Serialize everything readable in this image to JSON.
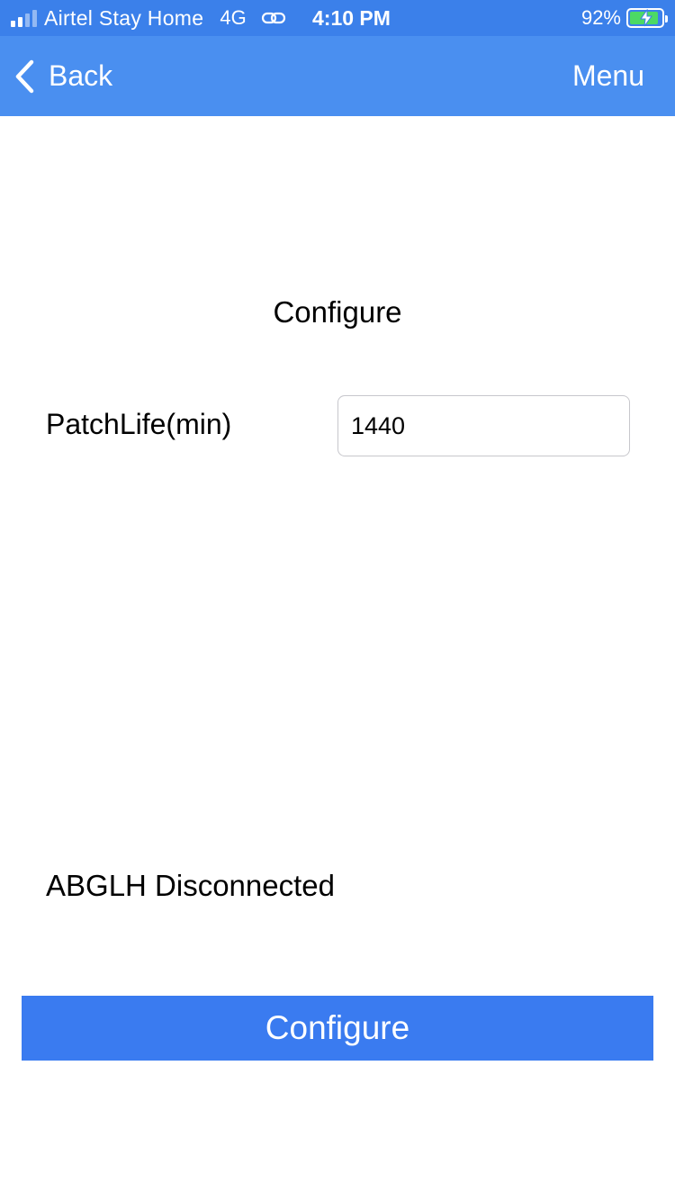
{
  "status_bar": {
    "carrier": "Airtel Stay Home",
    "network": "4G",
    "time": "4:10 PM",
    "battery_percent": "92%",
    "battery_level": 0.92,
    "signal_bars_active": 2,
    "signal_bars_total": 4
  },
  "nav": {
    "back_label": "Back",
    "menu_label": "Menu"
  },
  "main": {
    "title": "Configure",
    "field_label": "PatchLife(min)",
    "field_value": "1440",
    "connection_status": "ABGLH Disconnected",
    "configure_button_label": "Configure"
  },
  "colors": {
    "status_bar_bg": "#3b80ea",
    "nav_bar_bg": "#4a8ff0",
    "button_bg": "#3a7bf0",
    "battery_fill": "#4cd964"
  },
  "icons": {
    "back": "chevron-left-icon",
    "link": "link-icon",
    "signal": "signal-icon",
    "battery": "battery-charging-icon"
  }
}
